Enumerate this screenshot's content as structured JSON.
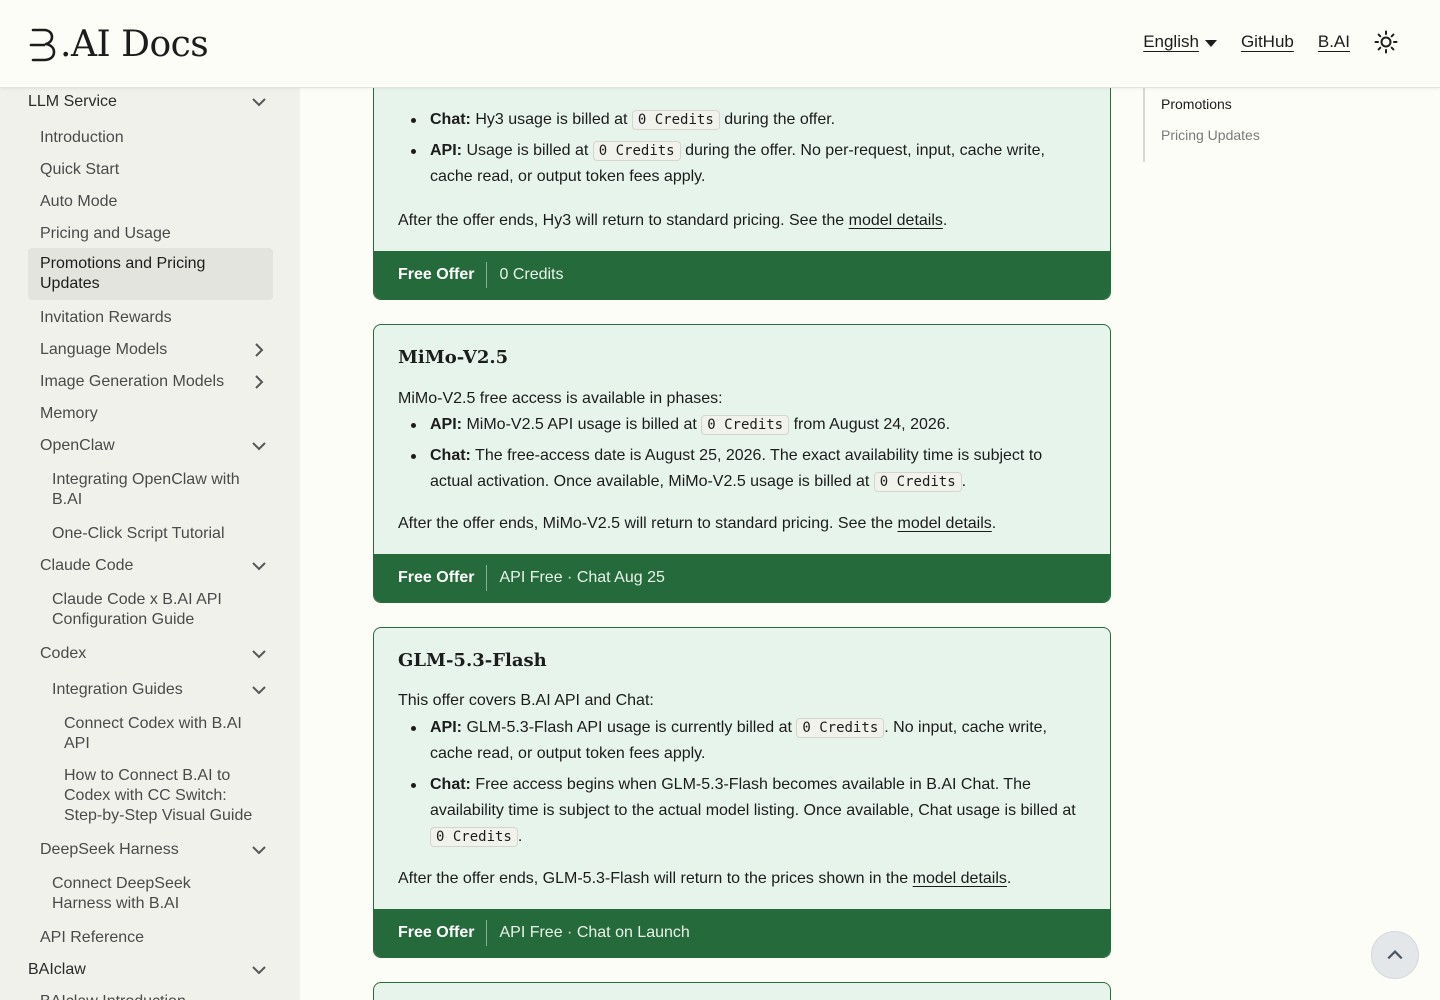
{
  "header": {
    "logo_text": ".AI Docs",
    "language": "English",
    "github": "GitHub",
    "bai": "B.AI"
  },
  "sidebar": {
    "items": [
      {
        "label": "LLM Service",
        "expanded": true
      },
      {
        "label": "Introduction"
      },
      {
        "label": "Quick Start"
      },
      {
        "label": "Auto Mode"
      },
      {
        "label": "Pricing and Usage"
      },
      {
        "label": "Promotions and Pricing Updates",
        "active": true
      },
      {
        "label": "Invitation Rewards"
      },
      {
        "label": "Language Models",
        "expanded": false
      },
      {
        "label": "Image Generation Models",
        "expanded": false
      },
      {
        "label": "Memory"
      },
      {
        "label": "OpenClaw",
        "expanded": true
      },
      {
        "label": "Integrating OpenClaw with B.AI"
      },
      {
        "label": "One-Click Script Tutorial"
      },
      {
        "label": "Claude Code",
        "expanded": true
      },
      {
        "label": "Claude Code x B.AI API Configuration Guide"
      },
      {
        "label": "Codex",
        "expanded": true
      },
      {
        "label": "Integration Guides",
        "expanded": true
      },
      {
        "label": "Connect Codex with B.AI API"
      },
      {
        "label": "How to Connect B.AI to Codex with CC Switch: Step-by-Step Visual Guide"
      },
      {
        "label": "DeepSeek Harness",
        "expanded": true
      },
      {
        "label": "Connect DeepSeek Harness with B.AI"
      },
      {
        "label": "API Reference"
      },
      {
        "label": "BAIclaw",
        "expanded": true
      },
      {
        "label": "BAIclaw Introduction"
      }
    ]
  },
  "toc": {
    "items": [
      "Promotions",
      "Pricing Updates"
    ]
  },
  "cards": [
    {
      "chat_label": "Chat:",
      "chat_text_a": "Hy3 usage is billed at",
      "chat_code": "0 Credits",
      "chat_text_b": "during the offer.",
      "api_label": "API:",
      "api_text_a": "Usage is billed at",
      "api_code": "0 Credits",
      "api_text_b": "during the offer. No per-request, input, cache write, cache read, or output token fees apply.",
      "after_a": "After the offer ends, Hy3 will return to standard pricing. See the",
      "after_link": "model details",
      "after_b": ".",
      "footer_tag": "Free Offer",
      "footer_val": "0 Credits"
    },
    {
      "title": "MiMo-V2.5",
      "intro": "MiMo-V2.5 free access is available in phases:",
      "api_label": "API:",
      "api_text_a": "MiMo-V2.5 API usage is billed at",
      "api_code": "0 Credits",
      "api_text_b": "from August 24, 2026.",
      "chat_label": "Chat:",
      "chat_text_a": "The free-access date is August 25, 2026. The exact availability time is subject to actual activation. Once available, MiMo-V2.5 usage is billed at",
      "chat_code": "0 Credits",
      "chat_text_b": ".",
      "after_a": "After the offer ends, MiMo-V2.5 will return to standard pricing. See the",
      "after_link": "model details",
      "after_b": ".",
      "footer_tag": "Free Offer",
      "footer_val": "API Free · Chat Aug 25"
    },
    {
      "title": "GLM-5.3-Flash",
      "intro": "This offer covers B.AI API and Chat:",
      "api_label": "API:",
      "api_text_a": "GLM-5.3-Flash API usage is currently billed at",
      "api_code": "0 Credits",
      "api_text_b": ". No input, cache write, cache read, or output token fees apply.",
      "chat_label": "Chat:",
      "chat_text_a": "Free access begins when GLM-5.3-Flash becomes available in B.AI Chat. The availability time is subject to the actual model listing. Once available, Chat usage is billed at",
      "chat_code": "0 Credits",
      "chat_text_b": ".",
      "after_a": "After the offer ends, GLM-5.3-Flash will return to the prices shown in the",
      "after_link": "model details",
      "after_b": ".",
      "footer_tag": "Free Offer",
      "footer_val": "API Free · Chat on Launch"
    }
  ],
  "colors": {
    "card_bg": "#e7f4eb",
    "card_border": "#2a6b3c",
    "footer_bg": "#256a3b",
    "sidebar_bg": "#f1f1ec",
    "active_bg": "#e4e4de"
  }
}
